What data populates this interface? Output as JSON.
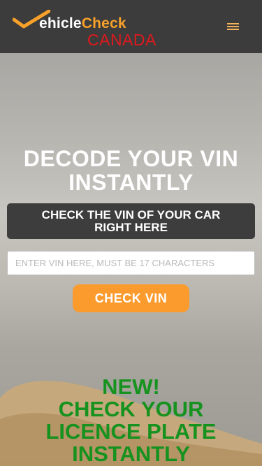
{
  "header": {
    "logo": {
      "main_part1": "ehicle",
      "main_part2": "Check",
      "sub": "CANADA"
    },
    "menu_icon": "hamburger-menu-icon"
  },
  "hero": {
    "title_line1": "DECODE YOUR VIN",
    "title_line2": "INSTANTLY",
    "subtitle_line1": "CHECK THE VIN OF YOUR CAR",
    "subtitle_line2": "RIGHT HERE"
  },
  "vin_form": {
    "placeholder": "ENTER VIN HERE, MUST BE 17 CHARACTERS",
    "value": "",
    "button_label": "CHECK VIN"
  },
  "promo": {
    "line1": "NEW!",
    "line2": "CHECK YOUR",
    "line3": "LICENCE PLATE",
    "line4": "INSTANTLY"
  },
  "colors": {
    "header_bg": "#3c3c3c",
    "accent_orange": "#fb9b2e",
    "logo_red": "#e0191d",
    "promo_green": "#16921e",
    "subtitle_box_bg": "#3d3d3d"
  }
}
